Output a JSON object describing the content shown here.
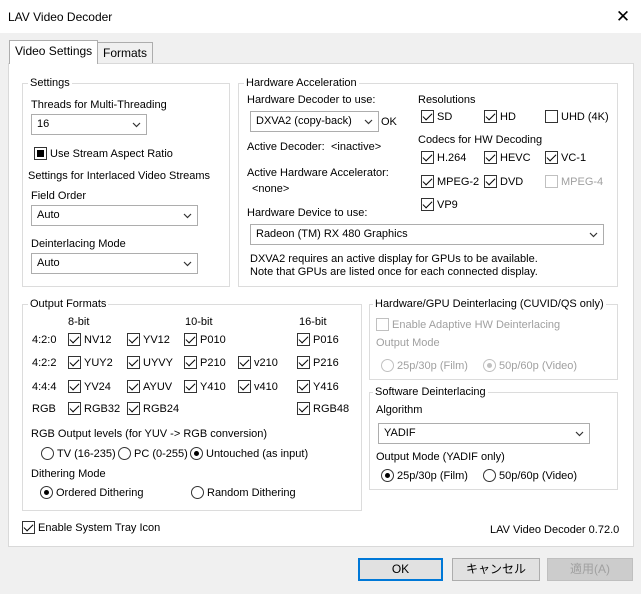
{
  "window": {
    "title": "LAV Video Decoder"
  },
  "tabs": [
    "Video Settings",
    "Formats"
  ],
  "settings": {
    "title": "Settings",
    "threads_label": "Threads for Multi-Threading",
    "threads_value": "16",
    "stream_aspect_label": "Use Stream Aspect Ratio",
    "interlaced_label": "Settings for Interlaced Video Streams",
    "field_order_label": "Field Order",
    "field_order_value": "Auto",
    "deint_mode_label": "Deinterlacing Mode",
    "deint_mode_value": "Auto"
  },
  "hwaccel": {
    "title": "Hardware Acceleration",
    "decoder_label": "Hardware Decoder to use:",
    "decoder_value": "DXVA2 (copy-back)",
    "decoder_status": "OK",
    "active_decoder_label": "Active Decoder:",
    "active_decoder_value": "<inactive>",
    "active_accel_label": "Active Hardware Accelerator:",
    "active_accel_value": "<none>",
    "device_label": "Hardware Device to use:",
    "device_value": "Radeon (TM) RX 480 Graphics",
    "note_line1": "DXVA2 requires an active display for GPUs to be available.",
    "note_line2": "Note that GPUs are listed once for each connected display.",
    "resolutions_label": "Resolutions",
    "res_sd": "SD",
    "res_hd": "HD",
    "res_uhd": "UHD (4K)",
    "codecs_label": "Codecs for HW Decoding",
    "codec_h264": "H.264",
    "codec_hevc": "HEVC",
    "codec_vc1": "VC-1",
    "codec_mpeg2": "MPEG-2",
    "codec_dvd": "DVD",
    "codec_mpeg4": "MPEG-4",
    "codec_vp9": "VP9"
  },
  "output": {
    "title": "Output Formats",
    "col_8bit": "8-bit",
    "col_10bit": "10-bit",
    "col_16bit": "16-bit",
    "row_420": "4:2:0",
    "row_422": "4:2:2",
    "row_444": "4:4:4",
    "row_rgb": "RGB",
    "nv12": "NV12",
    "yv12": "YV12",
    "p010": "P010",
    "p016": "P016",
    "yuy2": "YUY2",
    "uyvy": "UYVY",
    "p210": "P210",
    "v210": "v210",
    "p216": "P216",
    "yv24": "YV24",
    "ayuv": "AYUV",
    "y410": "Y410",
    "v410": "v410",
    "y416": "Y416",
    "rgb32": "RGB32",
    "rgb24": "RGB24",
    "rgb48": "RGB48",
    "levels_label": "RGB Output levels (for YUV -> RGB conversion)",
    "lvl_tv": "TV (16-235)",
    "lvl_pc": "PC (0-255)",
    "lvl_untouched": "Untouched (as input)",
    "dither_label": "Dithering Mode",
    "dither_ordered": "Ordered Dithering",
    "dither_random": "Random Dithering"
  },
  "hwdeint": {
    "title": "Hardware/GPU Deinterlacing (CUVID/QS only)",
    "adaptive_label": "Enable Adaptive HW Deinterlacing",
    "output_mode_label": "Output Mode",
    "opt_25": "25p/30p (Film)",
    "opt_50": "50p/60p (Video)"
  },
  "swdeint": {
    "title": "Software Deinterlacing",
    "algorithm_label": "Algorithm",
    "algorithm_value": "YADIF",
    "output_mode_label": "Output Mode (YADIF only)",
    "opt_25": "25p/30p (Film)",
    "opt_50": "50p/60p (Video)"
  },
  "footer": {
    "tray_label": "Enable System Tray Icon",
    "version": "LAV Video Decoder 0.72.0",
    "ok": "OK",
    "cancel": "キャンセル",
    "apply": "適用(A)"
  },
  "icons": {
    "close": "close-icon",
    "dropdown": "chevron-down-icon"
  },
  "colors": {
    "accent": "#0078d7",
    "disabled_text": "#a0a0a0"
  }
}
